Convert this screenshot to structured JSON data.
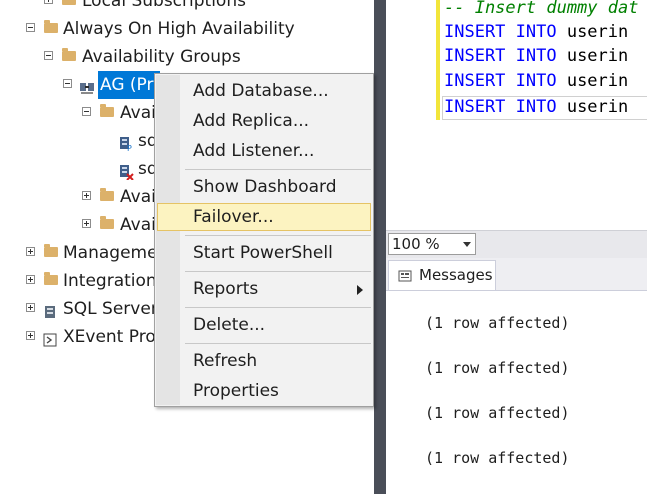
{
  "tree": {
    "local_subscriptions": "Local Subscriptions",
    "always_on": "Always On High Availability",
    "availability_groups": "Availability Groups",
    "ag_node": "AG (Pri",
    "avail_replicas": "Avai",
    "replica_1": "sq",
    "replica_2": "sq",
    "avail_databases": "Avai",
    "avail_listeners": "Avai",
    "management": "Manageme",
    "integration": "Integration",
    "sql_agent": "SQL Server",
    "xevent": "XEvent Prof"
  },
  "editor": {
    "lines": [
      {
        "kw": "",
        "comment": "-- Insert dummy dat",
        "rest": ""
      },
      {
        "kw": "INSERT INTO",
        "comment": "",
        "rest": " userin"
      },
      {
        "kw": "INSERT INTO",
        "comment": "",
        "rest": " userin"
      },
      {
        "kw": "INSERT INTO",
        "comment": "",
        "rest": " userin"
      },
      {
        "kw": "INSERT INTO",
        "comment": "",
        "rest": " userin"
      }
    ]
  },
  "zoom": {
    "value": "100 %"
  },
  "results": {
    "tab_label": "Messages",
    "messages": [
      "(1 row affected)",
      "(1 row affected)",
      "(1 row affected)",
      "(1 row affected)"
    ]
  },
  "context_menu": {
    "items": [
      {
        "label": "Add Database..."
      },
      {
        "label": "Add Replica..."
      },
      {
        "label": "Add Listener..."
      },
      {
        "label": "Show Dashboard"
      },
      {
        "label": "Failover..."
      },
      {
        "label": "Start PowerShell"
      },
      {
        "label": "Reports"
      },
      {
        "label": "Delete..."
      },
      {
        "label": "Refresh"
      },
      {
        "label": "Properties"
      }
    ]
  },
  "colors": {
    "selection": "#0078d7",
    "menu_highlight": "#fcf3c1",
    "keyword": "#0000ff",
    "comment": "#008000",
    "folder": "#dcb16a"
  }
}
